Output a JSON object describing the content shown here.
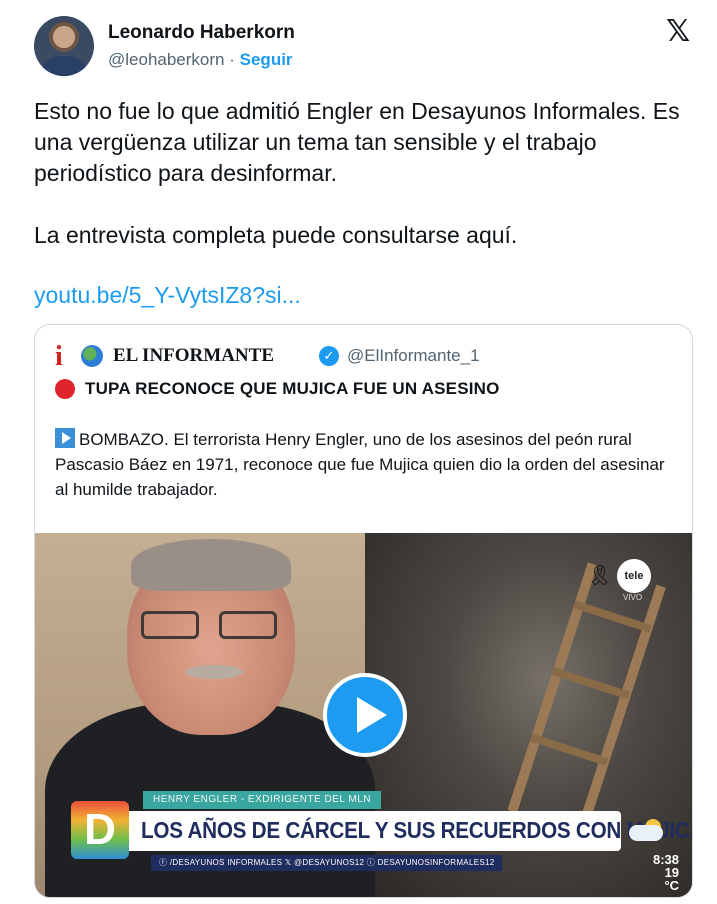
{
  "author": {
    "name": "Leonardo Haberkorn",
    "handle": "@leohaberkorn",
    "separator": "·",
    "follow_label": "Seguir"
  },
  "platform_icon": "x-logo-icon",
  "tweet": {
    "paragraph1": "Esto no fue lo que admitió Engler en Desayunos Informales. Es una vergüenza utilizar un tema tan sensible y el trabajo periodístico para desinformar.",
    "paragraph2": "La entrevista completa puede consultarse aquí.",
    "link": "youtu.be/5_Y-VytsIZ8?si..."
  },
  "quoted": {
    "icon_letter": "i",
    "name": "EL INFORMANTE",
    "handle": "@ElInformante_1",
    "headline": "TUPA RECONOCE QUE MUJICA FUE UN ASESINO",
    "body": "BOMBAZO. El terrorista Henry Engler, uno de los asesinos del peón rural Pascasio Báez en 1971, reconoce que fue Mujica quien dio la orden del asesinar al humilde trabajador."
  },
  "video": {
    "channel_logo": "tele",
    "channel_sub": "VIVO",
    "lower_third_name": "HENRY ENGLER - EXDIRIGENTE DEL MLN",
    "lower_third_title": "LOS AÑOS DE CÁRCEL Y SUS RECUERDOS CON MUJICA",
    "show_logo": "D",
    "social": "ⓕ /DESAYUNOS INFORMALES   𝕏 @DESAYUNOS12   ⓘ DESAYUNOSINFORMALES12",
    "time": "8:38",
    "temp": "19 °C"
  },
  "colors": {
    "accent": "#1d9bf0",
    "text": "#0f1419",
    "muted": "#536471",
    "headline_dot": "#e0242c"
  }
}
